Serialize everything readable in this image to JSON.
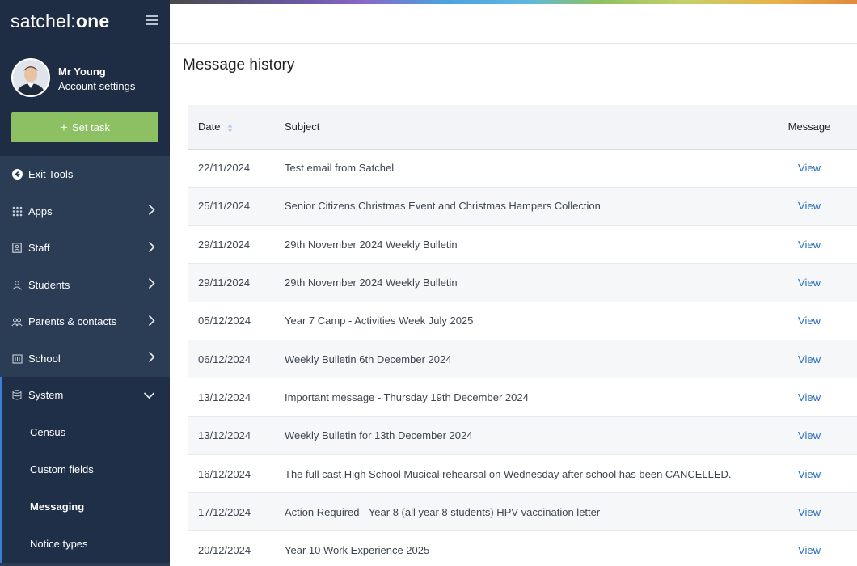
{
  "brand": {
    "name_light": "satchel:",
    "name_bold": "one"
  },
  "profile": {
    "name": "Mr Young",
    "account_link": "Account settings"
  },
  "set_task": {
    "label": "Set task"
  },
  "nav": {
    "exit": "Exit Tools",
    "apps": "Apps",
    "staff": "Staff",
    "students": "Students",
    "parents": "Parents & contacts",
    "school": "School",
    "system": "System",
    "sub": {
      "census": "Census",
      "custom_fields": "Custom fields",
      "messaging": "Messaging",
      "notice_types": "Notice types"
    }
  },
  "page": {
    "title": "Message history"
  },
  "table": {
    "headers": {
      "date": "Date",
      "subject": "Subject",
      "message": "Message"
    },
    "rows": [
      {
        "date": "22/11/2024",
        "subject": "Test email from Satchel",
        "action": "View"
      },
      {
        "date": "25/11/2024",
        "subject": "Senior Citizens Christmas Event and Christmas Hampers Collection",
        "action": "View"
      },
      {
        "date": "29/11/2024",
        "subject": "29th November 2024 Weekly Bulletin",
        "action": "View"
      },
      {
        "date": "29/11/2024",
        "subject": "29th November 2024 Weekly Bulletin",
        "action": "View"
      },
      {
        "date": "05/12/2024",
        "subject": "Year 7 Camp - Activities Week July 2025",
        "action": "View"
      },
      {
        "date": "06/12/2024",
        "subject": "Weekly Bulletin 6th December 2024",
        "action": "View"
      },
      {
        "date": "13/12/2024",
        "subject": "Important message - Thursday 19th December 2024",
        "action": "View"
      },
      {
        "date": "13/12/2024",
        "subject": "Weekly Bulletin for 13th December 2024",
        "action": "View"
      },
      {
        "date": "16/12/2024",
        "subject": "The full cast High School Musical rehearsal on Wednesday after school has been CANCELLED.",
        "action": "View"
      },
      {
        "date": "17/12/2024",
        "subject": "Action Required - Year 8 (all year 8 students) HPV vaccination letter",
        "action": "View"
      },
      {
        "date": "20/12/2024",
        "subject": "Year 10 Work Experience 2025",
        "action": "View"
      }
    ]
  },
  "colors": {
    "sidebar": "#2b3d55",
    "sidebar_top": "#1e2d44",
    "accent_green": "#8cc063",
    "link_blue": "#2a6fba",
    "active_border": "#3c7fd9"
  },
  "icons": {
    "menu": "hamburger-icon",
    "exit": "arrow-left-circle-icon",
    "apps": "grid-dots-icon",
    "staff": "id-badge-icon",
    "students": "student-icon",
    "parents": "people-icon",
    "school": "building-icon",
    "system": "database-icon",
    "chevron_right": "chevron-right-icon",
    "chevron_down": "chevron-down-icon",
    "sort": "sort-icon"
  }
}
